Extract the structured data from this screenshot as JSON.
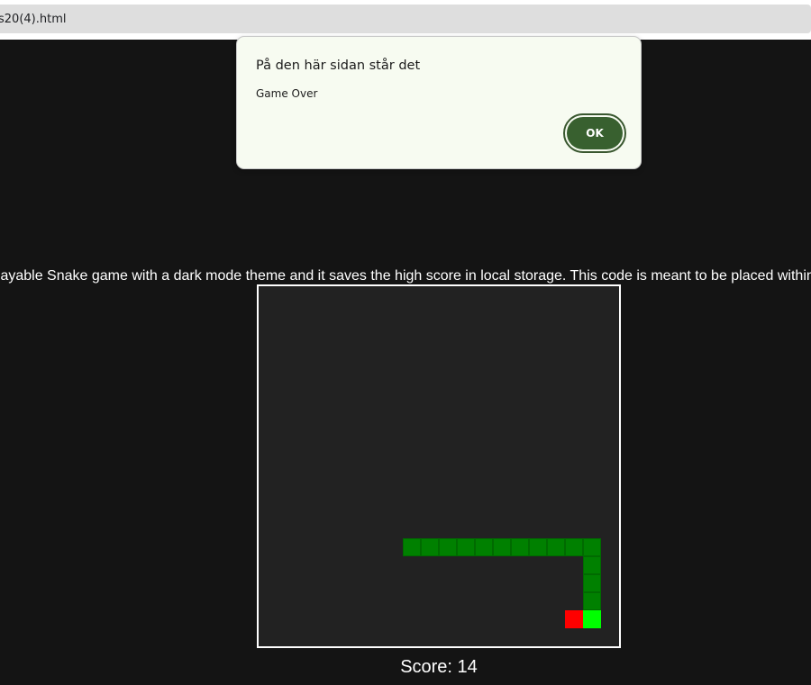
{
  "browser": {
    "url_text": "s20(4).html"
  },
  "page": {
    "intro_text": "playable Snake game with a dark mode theme and it saves the high score in local storage. This code is meant to be placed within",
    "score_label": "Score: 14",
    "score": 14
  },
  "game": {
    "grid_columns": 20,
    "grid_rows": 20,
    "snake_body_color": "#008000",
    "snake_head_color": "#00ff00",
    "food_color": "#ff0000",
    "board_color": "#222222",
    "board_border_color": "#ffffff",
    "snake_head": [
      18,
      18
    ],
    "snake_body": [
      [
        18,
        17
      ],
      [
        18,
        16
      ],
      [
        18,
        15
      ],
      [
        18,
        14
      ],
      [
        17,
        14
      ],
      [
        16,
        14
      ],
      [
        15,
        14
      ],
      [
        14,
        14
      ],
      [
        13,
        14
      ],
      [
        12,
        14
      ],
      [
        11,
        14
      ],
      [
        10,
        14
      ],
      [
        9,
        14
      ],
      [
        8,
        14
      ]
    ],
    "food": [
      17,
      18
    ]
  },
  "dialog": {
    "title": "På den här sidan står det",
    "message": "Game Over",
    "ok_label": "OK"
  }
}
